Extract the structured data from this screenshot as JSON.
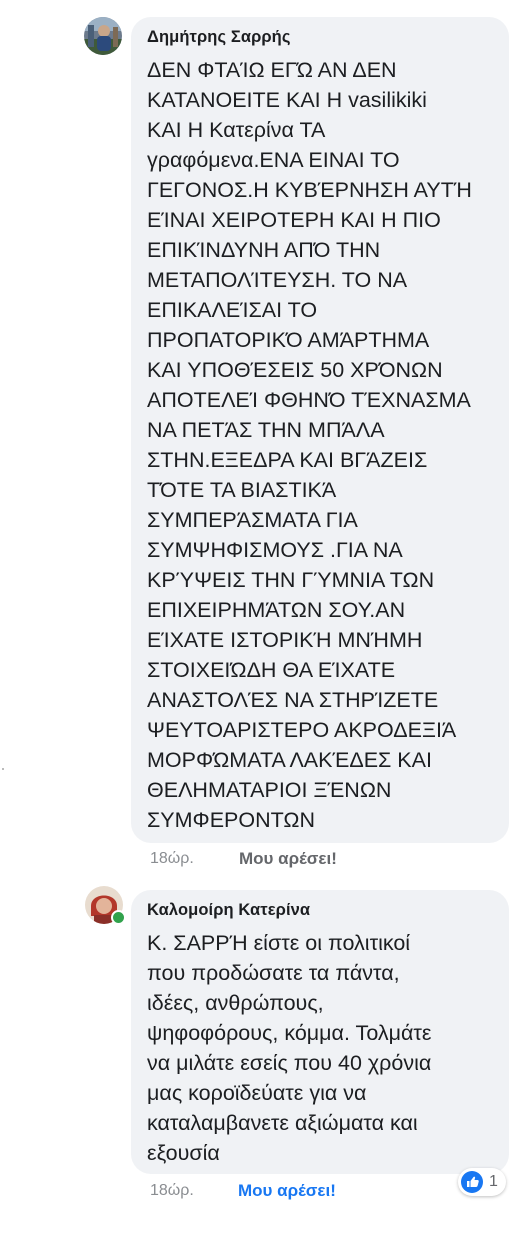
{
  "colors": {
    "bubble": "#f0f2f5",
    "text": "#1c1e21",
    "meta": "#8a8d91",
    "like_inactive": "#65676b",
    "like_active": "#1877f2",
    "online": "#31a24c"
  },
  "comments": [
    {
      "author": "Δημήτρης Σαρρής",
      "text": "ΔΕΝ ΦΤΑΊΩ ΕΓΏ ΑΝ ΔΕΝ\nΚΑΤΑΝΟΕΙΤΕ ΚΑΙ Η vasilikiki\nΚΑΙ Η Κατερίνα ΤΑ\nγραφόμενα.ΕΝΑ ΕΙΝΑΙ ΤΟ\nΓΕΓΟΝΟΣ.Η ΚΥΒΈΡΝΗΣΗ ΑΥΤΉ\nΕΊΝΑΙ  ΧΕΙΡΟΤΕΡΗ ΚΑΙ Η ΠΙΟ\nΕΠΙΚΊΝΔΥΝΗ ΑΠΌ ΤΗΝ\nΜΕΤΑΠΟΛΊΤΕΥΣΗ. ΤΟ ΝΑ\nΕΠΙΚΑΛΕΊΣΑΙ ΤΟ\nΠΡΟΠΑΤΟΡΙΚΌ ΑΜΆΡΤΗΜΑ\nΚΑΙ ΥΠΟΘΈΣΕΙΣ 50 ΧΡΌΝΩΝ\nΑΠΟΤΕΛΕΊ ΦΘΗΝΌ ΤΈΧΝΑΣΜΑ\nΝΑ ΠΕΤΆΣ ΤΗΝ ΜΠΆΛΑ\nΣΤΗΝ.ΕΞΕΔΡΑ ΚΑΙ ΒΓΆΖΕΙΣ\nΤΌΤΕ ΤΑ ΒΙΑΣΤΙΚΆ\nΣΥΜΠΕΡΆΣΜΑΤΑ ΓΙΑ\nΣΥΜΨΗΦΙΣΜΟΥΣ .ΓΙΑ ΝΑ\nΚΡΎΨΕΙΣ ΤΗΝ ΓΎΜΝΙΑ ΤΩΝ\nΕΠΙΧΕΙΡΗΜΆΤΩΝ ΣΟΥ.ΑΝ\nΕΊΧΑΤΕ ΙΣΤΟΡΙΚΉ ΜΝΉΜΗ\nΣΤΟΙΧΕΙΏΔΗ ΘΑ ΕΊΧΑΤΕ\nΑΝΑΣΤΟΛΈΣ ΝΑ ΣΤΗΡΊΖΕΤΕ\nΨΕΥΤΟΑΡΙΣΤΕΡΟ ΑΚΡΟΔΕΞΙΆ\nΜΟΡΦΏΜΑΤΑ ΛΑΚΈΔΕΣ ΚΑΙ\nΘΕΛΗΜΑΤΑΡΙΟΙ ΞΈΝΩΝ\nΣΥΜΦΕΡΟΝΤΩΝ",
      "time": "18ώρ.",
      "like_label": "Μου αρέσει!",
      "liked": false
    },
    {
      "author": "Καλομοίρη Κατερίνα",
      "text": "Κ. ΣΑΡΡΉ  είστε οι πολιτικοί\nπου προδώσατε τα πάντα,\nιδέες, ανθρώπους,\nψηφοφόρους, κόμμα. Τολμάτε\nνα μιλάτε εσείς που 40 χρόνια\nμας κοροϊδεύατε για να\nκαταλαμβανετε αξιώματα και\nεξουσία",
      "time": "18ώρ.",
      "like_label": "Μου αρέσει!",
      "liked": true,
      "online": true,
      "reactions": {
        "icon": "thumbs-up-icon",
        "count": "1"
      }
    }
  ]
}
